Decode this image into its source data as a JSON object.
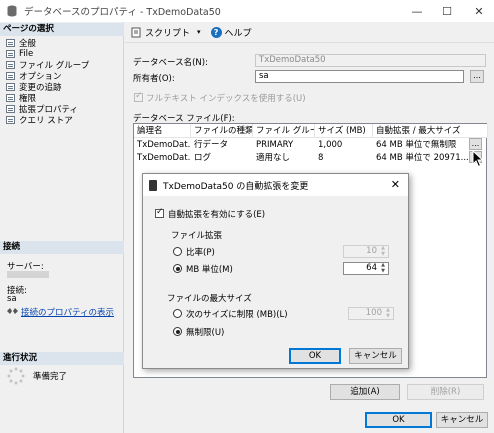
{
  "window": {
    "title": "データベースのプロパティ - TxDemoData50"
  },
  "left_panel": {
    "pages_header": "ページの選択",
    "pages": [
      "全般",
      "File",
      "ファイル グループ",
      "オプション",
      "変更の追跡",
      "権限",
      "拡張プロパティ",
      "クエリ ストア"
    ],
    "connection_header": "接続",
    "server_label": "サーバー:",
    "connection_label": "接続:",
    "connection_value": "sa",
    "connection_link": "接続のプロパティの表示",
    "progress_header": "進行状況",
    "progress_status": "準備完了"
  },
  "toolbar": {
    "script_label": "スクリプト",
    "help_label": "ヘルプ"
  },
  "form": {
    "db_name_label": "データベース名(N):",
    "db_name_value": "TxDemoData50",
    "owner_label": "所有者(O):",
    "owner_value": "sa",
    "fulltext_label": "フルテキスト インデックスを使用する(U)",
    "files_label": "データベース ファイル(F):"
  },
  "grid": {
    "columns": [
      "論理名",
      "ファイルの種類",
      "ファイル グループ",
      "サイズ (MB)",
      "自動拡張 / 最大サイズ"
    ],
    "rows": [
      [
        "TxDemoDat...",
        "行データ",
        "PRIMARY",
        "1,000",
        "64 MB 単位で無制限"
      ],
      [
        "TxDemoDat...",
        "ログ",
        "適用なし",
        "8",
        "64 MB 単位で 20971..."
      ]
    ]
  },
  "buttons": {
    "add": "追加(A)",
    "remove": "削除(R)",
    "ok": "OK",
    "cancel": "キャンセル"
  },
  "dialog": {
    "title": "TxDemoData50 の自動拡張を変更",
    "enable_autogrow": "自動拡張を有効にする(E)",
    "growth_group": "ファイル拡張",
    "percent_label": "比率(P)",
    "percent_value": "10",
    "mb_label": "MB 単位(M)",
    "mb_value": "64",
    "maxsize_group": "ファイルの最大サイズ",
    "limited_label": "次のサイズに制限 (MB)(L)",
    "limited_value": "100",
    "unlimited_label": "無制限(U)",
    "ok": "OK",
    "cancel": "キャンセル"
  }
}
